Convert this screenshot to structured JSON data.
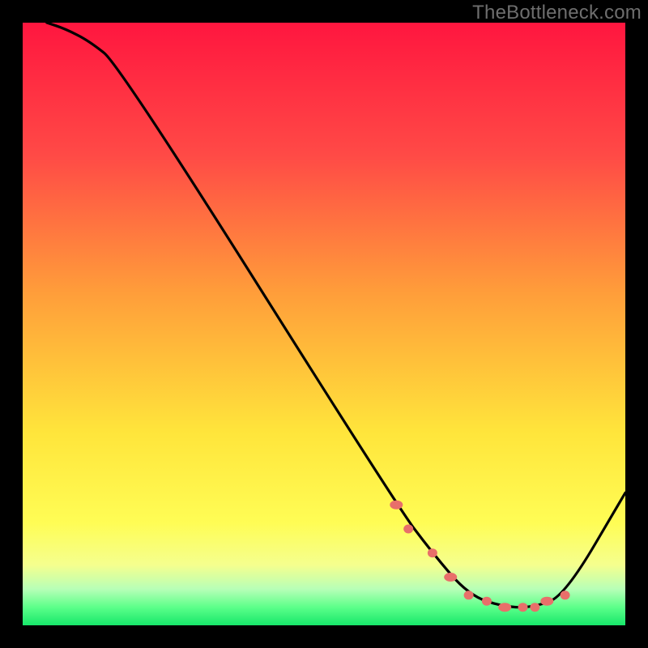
{
  "watermark": "TheBottleneck.com",
  "chart_data": {
    "type": "line",
    "title": "",
    "xlabel": "",
    "ylabel": "",
    "xlim": [
      0,
      100
    ],
    "ylim": [
      0,
      100
    ],
    "grid": false,
    "gradient_stops": [
      {
        "pct": 0,
        "color": "#ff163f"
      },
      {
        "pct": 22,
        "color": "#ff4a46"
      },
      {
        "pct": 45,
        "color": "#ff9e3a"
      },
      {
        "pct": 68,
        "color": "#ffe53b"
      },
      {
        "pct": 83,
        "color": "#fffd55"
      },
      {
        "pct": 90,
        "color": "#f5ff8e"
      },
      {
        "pct": 94,
        "color": "#b7ffb7"
      },
      {
        "pct": 97,
        "color": "#5cff8a"
      },
      {
        "pct": 100,
        "color": "#17e76a"
      }
    ],
    "series": [
      {
        "name": "bottleneck-curve",
        "x": [
          4,
          7,
          11,
          16,
          62,
          68,
          74,
          80,
          85,
          90,
          100
        ],
        "y": [
          100,
          99,
          97,
          93,
          20,
          12,
          5,
          3,
          3,
          5,
          22
        ]
      }
    ],
    "markers": {
      "name": "highlight-dots",
      "color": "#e86f6a",
      "x": [
        62,
        64,
        68,
        71,
        74,
        77,
        80,
        83,
        85,
        87,
        90
      ],
      "y": [
        20,
        16,
        12,
        8,
        5,
        4,
        3,
        3,
        3,
        4,
        5
      ]
    }
  }
}
